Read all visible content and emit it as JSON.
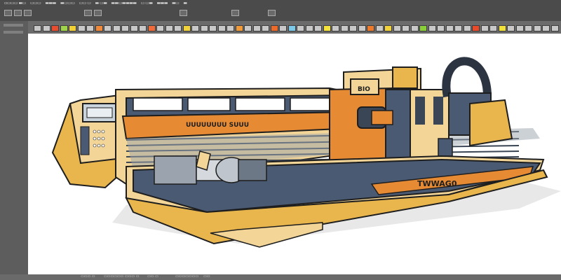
{
  "menu": {
    "items": [
      "▫▭▭▭ ▬▭",
      "▭▭▭",
      "▬▬▬",
      "▬▭▭▭",
      "▭▭ ▭",
      "▬ ▭▬",
      "▬▬▭▬▬▬▬",
      "▭ ▭▬",
      "▬▬▬",
      "▬▭",
      "▬"
    ]
  },
  "swatches": {
    "colors": [
      "#c8c8c8",
      "#c8c8c8",
      "#e84d2f",
      "#9ed34a",
      "#f2d137",
      "#c8c8c8",
      "#c8c8c8",
      "#f08a3a",
      "#c8c8c8",
      "#c8c8c8",
      "#c8c8c8",
      "#c8c8c8",
      "#c8c8c8",
      "#f06a3a",
      "#c8c8c8",
      "#c8c8c8",
      "#c8c8c8",
      "#f0d23a",
      "#c8c8c8",
      "#c8c8c8",
      "#c8c8c8",
      "#c8c8c8",
      "#c8c8c8",
      "#f09a3a",
      "#c8c8c8",
      "#c8c8c8",
      "#c8c8c8",
      "#ec6a2a",
      "#c8c8c8",
      "#7cc8e8",
      "#c8c8c8",
      "#c8c8c8",
      "#c8c8c8",
      "#f5e23a",
      "#c8c8c8",
      "#c8c8c8",
      "#c8c8c8",
      "#c8c8c8",
      "#ec7a2a",
      "#c8c8c8",
      "#f2d23a",
      "#c8c8c8",
      "#c8c8c8",
      "#c8c8c8",
      "#8acf3a",
      "#c8c8c8",
      "#c8c8c8",
      "#c8c8c8",
      "#c8c8c8",
      "#c8c8c8",
      "#e84a2a",
      "#c8c8c8",
      "#c8c8c8",
      "#f0e23a",
      "#c8c8c8",
      "#c8c8c8",
      "#c8c8c8",
      "#c8c8c8",
      "#c8c8c8",
      "#c8c8c8"
    ]
  },
  "artwork": {
    "description_icon": "industrial-machine-illustration",
    "panel_label": "BIO",
    "rail_label": "UUUUUUUU SUUU",
    "base_label": "TWWAG0"
  },
  "statusbar": {
    "items": [
      "▭▭▭ ▭",
      "▭▭▭▭▭▭ ▭▭▭ ▭",
      "▭▭ ▭",
      "▭▭▭▭▭▭▭",
      "▭▭"
    ]
  },
  "colors": {
    "machine_tan": "#f2d597",
    "machine_slate": "#4a5a72",
    "machine_orange": "#e78a34",
    "outline": "#1e1e1e"
  }
}
